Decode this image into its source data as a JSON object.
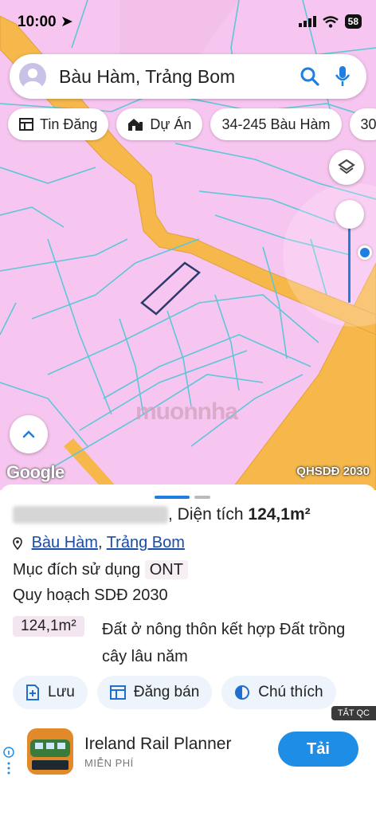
{
  "status": {
    "time": "10:00",
    "battery": "58"
  },
  "search": {
    "text": "Bàu Hàm, Trảng Bom"
  },
  "chips": [
    {
      "label": "Tin Đăng",
      "icon": "table-icon"
    },
    {
      "label": "Dự Án",
      "icon": "building-icon"
    },
    {
      "label": "34-245 Bàu Hàm",
      "icon": ""
    },
    {
      "label": "30",
      "icon": ""
    }
  ],
  "map": {
    "attribution": "Google",
    "layer_label": "QHSDĐ 2030",
    "watermark": "muonnha"
  },
  "colors": {
    "land_pink": "#f7c6f0",
    "road_orange": "#f6b84a",
    "parcel_line": "#5ec6d6",
    "accent_blue": "#1e8de6"
  },
  "parcel": {
    "area_label": "Diện tích",
    "area_value": "124,1m²",
    "commune": "Bàu Hàm",
    "district": "Trảng Bom",
    "purpose_label": "Mục đích sử dụng",
    "purpose_code": "ONT",
    "plan_label": "Quy hoạch SDĐ 2030",
    "plan_area": "124,1m²",
    "plan_desc": "Đất ở nông thôn kết hợp Đất trồng cây lâu năm"
  },
  "actions": {
    "save": "Lưu",
    "post_sale": "Đăng bán",
    "legend": "Chú thích"
  },
  "ad": {
    "close_label": "TẮT QC",
    "app_name": "Ireland Rail Planner",
    "price": "MIỄN PHÍ",
    "install": "Tải",
    "icon_text": "Ireland Rail Planner"
  }
}
